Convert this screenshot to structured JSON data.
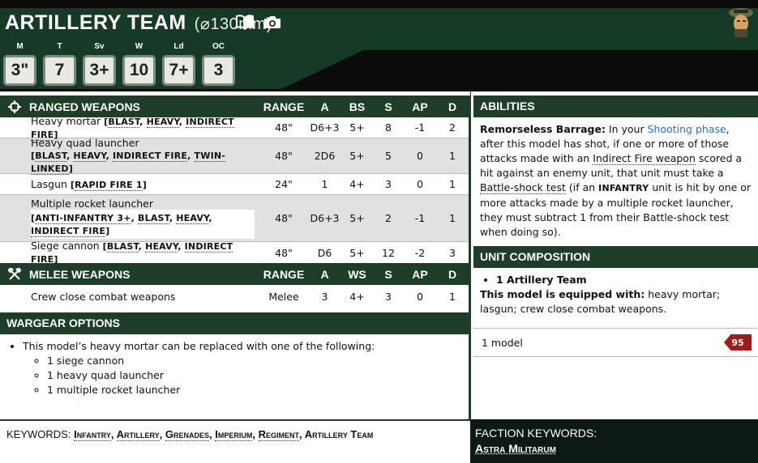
{
  "unit": {
    "name": "ARTILLERY TEAM",
    "base": "(⌀130mm)",
    "stats": [
      {
        "label": "M",
        "value": "3\""
      },
      {
        "label": "T",
        "value": "7"
      },
      {
        "label": "Sv",
        "value": "3+"
      },
      {
        "label": "W",
        "value": "10"
      },
      {
        "label": "Ld",
        "value": "7+"
      },
      {
        "label": "OC",
        "value": "3"
      }
    ]
  },
  "ranged": {
    "title": "RANGED WEAPONS",
    "cols": [
      "RANGE",
      "A",
      "BS",
      "S",
      "AP",
      "D"
    ],
    "rows": [
      {
        "name": "Heavy mortar",
        "kw": [
          "BLAST",
          "HEAVY",
          "INDIRECT FIRE"
        ],
        "range": "48\"",
        "a": "D6+3",
        "bs": "5+",
        "s": "8",
        "ap": "-1",
        "d": "2"
      },
      {
        "name": "Heavy quad launcher",
        "kw": [
          "BLAST",
          "HEAVY",
          "INDIRECT FIRE",
          "TWIN-LINKED"
        ],
        "range": "48\"",
        "a": "2D6",
        "bs": "5+",
        "s": "5",
        "ap": "0",
        "d": "1"
      },
      {
        "name": "Lasgun",
        "kw": [
          "RAPID FIRE 1"
        ],
        "range": "24\"",
        "a": "1",
        "bs": "4+",
        "s": "3",
        "ap": "0",
        "d": "1"
      },
      {
        "name": "Multiple rocket launcher",
        "kw": [
          "ANTI-INFANTRY 3+",
          "BLAST",
          "HEAVY",
          "INDIRECT FIRE"
        ],
        "range": "48\"",
        "a": "D6+3",
        "bs": "5+",
        "s": "2",
        "ap": "-1",
        "d": "1"
      },
      {
        "name": "Siege cannon",
        "kw": [
          "BLAST",
          "HEAVY",
          "INDIRECT FIRE"
        ],
        "range": "48\"",
        "a": "D6",
        "bs": "5+",
        "s": "12",
        "ap": "-2",
        "d": "3"
      }
    ]
  },
  "melee": {
    "title": "MELEE WEAPONS",
    "cols": [
      "RANGE",
      "A",
      "WS",
      "S",
      "AP",
      "D"
    ],
    "rows": [
      {
        "name": "Crew close combat weapons",
        "range": "Melee",
        "a": "3",
        "ws": "4+",
        "s": "3",
        "ap": "0",
        "d": "1"
      }
    ]
  },
  "wargear": {
    "title": "WARGEAR OPTIONS",
    "intro": "This model’s heavy mortar can be replaced with one of the following:",
    "options": [
      "1 siege cannon",
      "1 heavy quad launcher",
      "1 multiple rocket launcher"
    ]
  },
  "abilities": {
    "title": "ABILITIES",
    "name": "Remorseless Barrage:",
    "t1": " In your ",
    "link": "Shooting phase",
    "t2": ", after this model has shot, if one or more of those attacks made with an ",
    "d1": "Indirect Fire weapon",
    "t3": " scored a hit against an enemy unit, that unit must take a ",
    "d2": "Battle-shock test",
    "t4": " (if an ",
    "kw": "INFANTRY",
    "t5": " unit is hit by one or more attacks made by a multiple rocket launcher, they must subtract 1 from their Battle-shock test when doing so)."
  },
  "composition": {
    "title": "UNIT COMPOSITION",
    "item": "1 Artillery Team",
    "equip_label": "This model is equipped with:",
    "equip": " heavy mortar; lasgun; crew close combat weapons.",
    "models": "1 model",
    "cost": "95"
  },
  "keywords": {
    "label": "KEYWORDS: ",
    "items": [
      "Infantry",
      "Artillery",
      "Grenades",
      "Imperium",
      "Regiment",
      "Artillery Team"
    ]
  },
  "faction": {
    "label": "FACTION KEYWORDS:",
    "value": "Astra Militarum"
  },
  "colors": {
    "header_green": "#1e3e2a",
    "cost_red": "#9e1c1c",
    "link": "#2b6fc7"
  }
}
